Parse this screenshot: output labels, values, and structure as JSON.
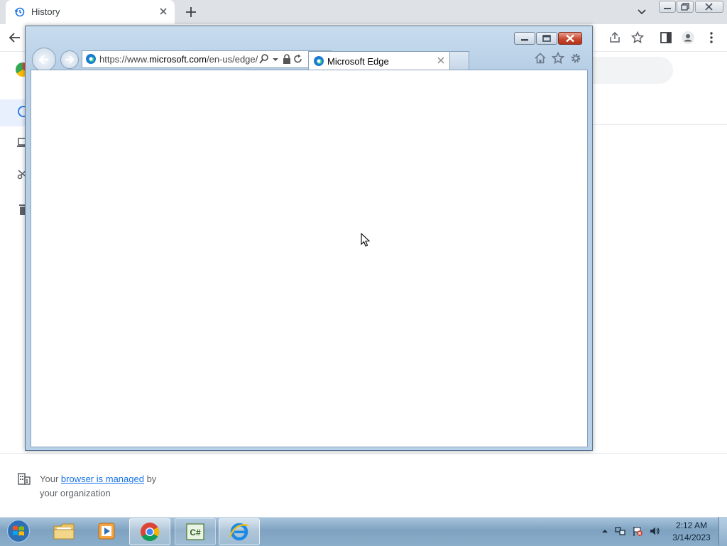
{
  "chrome": {
    "tab": {
      "title": "History",
      "icon": "history-icon"
    },
    "new_tab_icon": "plus-icon",
    "managed_notice": {
      "prefix": "Your ",
      "link": "browser is managed",
      "suffix": " by",
      "line2": "your organization"
    }
  },
  "ie": {
    "address": {
      "url_prefix": "https://www.",
      "url_domain": "microsoft.com",
      "url_path": "/en-us/edge/"
    },
    "tab": {
      "title": "Microsoft Edge"
    }
  },
  "taskbar": {
    "items": [
      {
        "name": "windows-explorer",
        "icon": "folder-icon"
      },
      {
        "name": "media-player",
        "icon": "media-player-icon"
      },
      {
        "name": "google-chrome",
        "icon": "chrome-icon"
      },
      {
        "name": "csharp-editor",
        "icon": "csharp-icon",
        "label": "C#"
      },
      {
        "name": "internet-explorer",
        "icon": "ie-icon"
      }
    ],
    "clock": {
      "time": "2:12 AM",
      "date": "3/14/2023"
    }
  },
  "colors": {
    "chrome_link": "#1a73e8",
    "ie_close": "#c84a31",
    "taskbar": "#8aaeca"
  }
}
